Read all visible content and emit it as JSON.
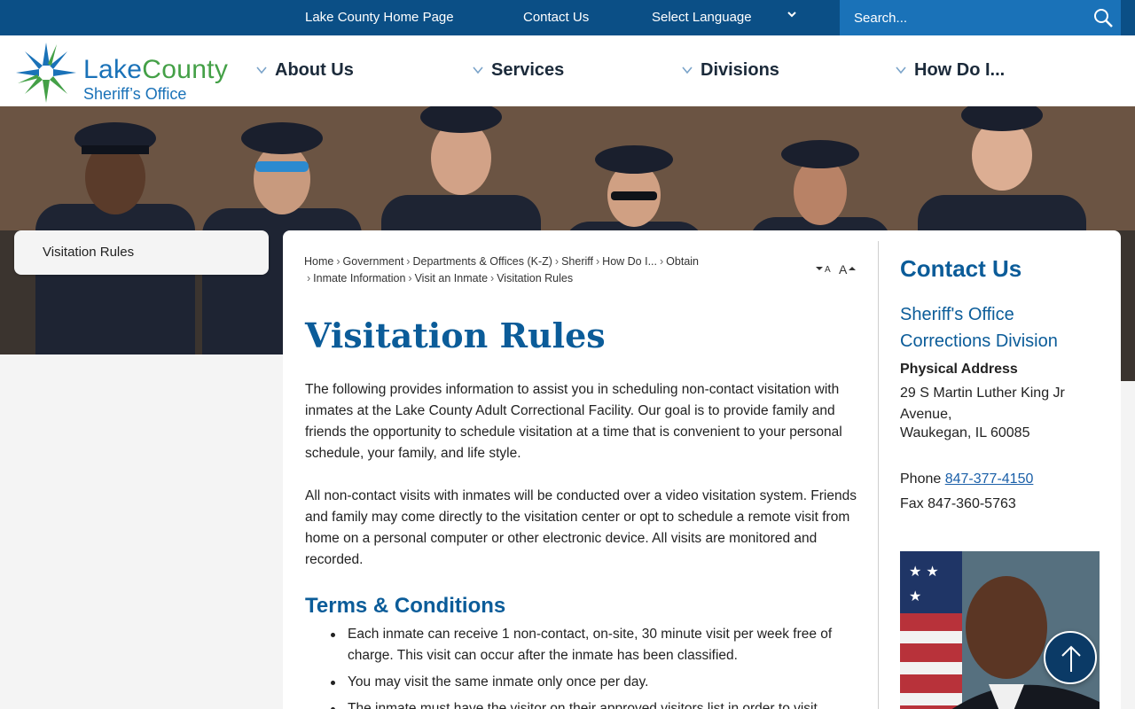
{
  "topbar": {
    "home_link": "Lake County Home Page",
    "contact_link": "Contact Us",
    "language_label": "Select Language",
    "search_placeholder": "Search..."
  },
  "logo": {
    "name_part1": "Lake",
    "name_part2": "County",
    "subtitle": "Sheriff’s Office"
  },
  "nav": {
    "items": [
      {
        "label": "About Us"
      },
      {
        "label": "Services"
      },
      {
        "label": "Divisions"
      },
      {
        "label": "How Do I..."
      }
    ]
  },
  "sidebar": {
    "items": [
      {
        "label": "Visitation Rules"
      }
    ]
  },
  "breadcrumb": {
    "items": [
      "Home",
      "Government",
      "Departments & Offices (K-Z)",
      "Sheriff",
      "How Do I...",
      "Obtain",
      "Inmate Information",
      "Visit an Inmate",
      "Visitation Rules"
    ]
  },
  "font_controls": {
    "decrease": "A",
    "increase": "A"
  },
  "main": {
    "title": "Visitation Rules",
    "para1": "The following provides information to assist you in scheduling non-contact visitation with inmates at the Lake County Adult Correctional Facility. Our goal is to provide family and friends the opportunity to schedule visitation at a time that is convenient to your personal schedule, your family, and life style.",
    "para2": "All non-contact visits with inmates will be conducted over a video visitation system. Friends and family may come directly to the visitation center or opt to schedule a remote visit from home on a personal computer or other electronic device. All visits are monitored and recorded.",
    "terms_title": "Terms & Conditions",
    "rules": [
      "Each inmate can receive 1 non-contact, on-site, 30 minute visit per week free of charge. This visit can occur after the inmate has been classified.",
      "You may visit the same inmate only once per day.",
      "The inmate must have the visitor on their approved visitors list in order to visit."
    ]
  },
  "contact": {
    "title": "Contact Us",
    "org_line1": "Sheriff's Office",
    "org_line2": "Corrections Division",
    "address_label": "Physical Address",
    "address_line1": "29 S Martin Luther King Jr Avenue,",
    "address_line2": "Waukegan, IL 60085",
    "phone_label": "Phone",
    "phone": "847-377-4150",
    "fax_label": "Fax",
    "fax": "847-360-5763"
  },
  "colors": {
    "topbar": "#0b4f86",
    "search_bg": "#1a72b8",
    "heading_blue": "#0b5c99",
    "logo_green": "#44a047"
  }
}
